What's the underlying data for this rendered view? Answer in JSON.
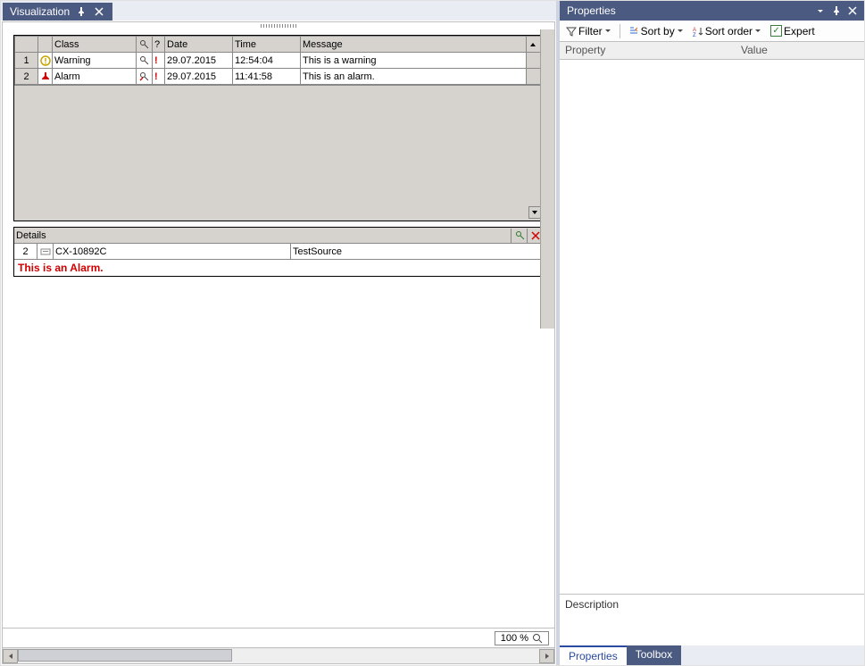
{
  "leftTab": {
    "label": "Visualization"
  },
  "alarms": {
    "headers": {
      "class": "Class",
      "date": "Date",
      "time": "Time",
      "message": "Message",
      "flag": "?"
    },
    "rows": [
      {
        "n": "1",
        "class": "Warning",
        "date": "29.07.2015",
        "time": "12:54:04",
        "message": "This is a warning",
        "kind": "warning"
      },
      {
        "n": "2",
        "class": "Alarm",
        "date": "29.07.2015",
        "time": "11:41:58",
        "message": "This is an alarm.",
        "kind": "alarm"
      }
    ]
  },
  "details": {
    "header": "Details",
    "row": {
      "n": "2",
      "device": "CX-10892C",
      "source": "TestSource"
    },
    "message": "This is an Alarm."
  },
  "zoom": "100 %",
  "properties": {
    "title": "Properties",
    "toolbar": {
      "filter": "Filter",
      "sortBy": "Sort by",
      "sortOrder": "Sort order",
      "expert": "Expert"
    },
    "columns": {
      "property": "Property",
      "value": "Value"
    },
    "descLabel": "Description"
  },
  "bottomTabs": {
    "properties": "Properties",
    "toolbox": "Toolbox"
  }
}
